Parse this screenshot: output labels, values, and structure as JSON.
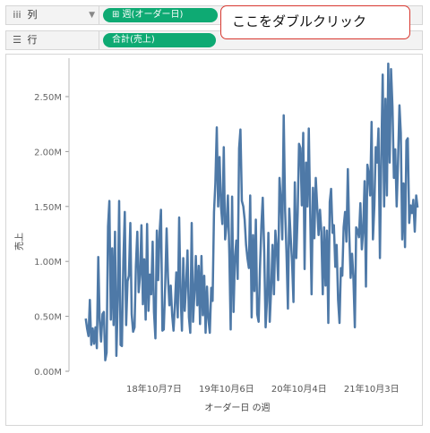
{
  "shelves": {
    "columns": {
      "icon": "iii",
      "label": "列",
      "pill": "⊞ 週(オーダー日)"
    },
    "rows": {
      "icon": "☰",
      "label": "行",
      "pill": "合計(売上)"
    }
  },
  "callout": {
    "text": "ここをダブルクリック"
  },
  "colors": {
    "pill": "#0eaa73",
    "line": "#4e79a7",
    "callout_border": "#d8372f"
  },
  "chart_data": {
    "type": "line",
    "xlabel": "オーダー日 の週",
    "ylabel": "売上",
    "ylim": [
      0,
      2850000
    ],
    "y_ticks": [
      {
        "value": 0,
        "label": "0.00M"
      },
      {
        "value": 500000,
        "label": "0.50M"
      },
      {
        "value": 1000000,
        "label": "1.00M"
      },
      {
        "value": 1500000,
        "label": "1.50M"
      },
      {
        "value": 2000000,
        "label": "2.00M"
      },
      {
        "value": 2500000,
        "label": "2.50M"
      }
    ],
    "x_ticks": [
      {
        "week_index": 49,
        "label": "18年10月7日"
      },
      {
        "week_index": 101,
        "label": "19年10月6日"
      },
      {
        "week_index": 153,
        "label": "20年10月4日"
      },
      {
        "week_index": 205,
        "label": "21年10月3日"
      }
    ],
    "x_range": [
      -12,
      236
    ],
    "grid": "none",
    "series": [
      {
        "values": [
          480000,
          390000,
          320000,
          650000,
          240000,
          390000,
          250000,
          400000,
          210000,
          1040000,
          470000,
          270000,
          520000,
          540000,
          100000,
          170000,
          1320000,
          1550000,
          470000,
          1120000,
          420000,
          1270000,
          140000,
          650000,
          1550000,
          240000,
          230000,
          1000000,
          1450000,
          420000,
          820000,
          870000,
          1350000,
          520000,
          360000,
          400000,
          960000,
          1270000,
          720000,
          880000,
          1330000,
          610000,
          1020000,
          470000,
          1340000,
          550000,
          880000,
          700000,
          1180000,
          540000,
          300000,
          1280000,
          830000,
          1270000,
          1470000,
          370000,
          380000,
          780000,
          1300000,
          860000,
          600000,
          780000,
          510000,
          370000,
          610000,
          900000,
          490000,
          1400000,
          720000,
          370000,
          1030000,
          550000,
          780000,
          1100000,
          490000,
          350000,
          1350000,
          450000,
          720000,
          1050000,
          600000,
          960000,
          430000,
          1050000,
          510000,
          870000,
          350000,
          770000,
          480000,
          350000,
          760000,
          640000,
          1450000,
          1710000,
          2220000,
          1500000,
          1950000,
          1500000,
          1340000,
          2040000,
          1200000,
          1330000,
          1600000,
          1070000,
          380000,
          1590000,
          540000,
          1020000,
          1190000,
          840000,
          2030000,
          2200000,
          1550000,
          1500000,
          1380000,
          1150000,
          1030000,
          940000,
          1600000,
          490000,
          1240000,
          730000,
          1380000,
          520000,
          450000,
          940000,
          1330000,
          1580000,
          1100000,
          400000,
          640000,
          1260000,
          450000,
          750000,
          1150000,
          700000,
          1280000,
          1120000,
          830000,
          1760000,
          1550000,
          1200000,
          2330000,
          1460000,
          1080000,
          570000,
          1480000,
          1220000,
          1000000,
          630000,
          1720000,
          1030000,
          1440000,
          2070000,
          2030000,
          1510000,
          2170000,
          930000,
          1900000,
          1500000,
          2210000,
          1430000,
          700000,
          1670000,
          1210000,
          1760000,
          1510000,
          1240000,
          1470000,
          1270000,
          700000,
          1310000,
          780000,
          1280000,
          440000,
          1540000,
          1660000,
          1260000,
          1330000,
          950000,
          1150000,
          650000,
          440000,
          940000,
          870000,
          1310000,
          1450000,
          1180000,
          1840000,
          1270000,
          850000,
          1070000,
          850000,
          400000,
          1310000,
          1280000,
          1220000,
          1530000,
          1110000,
          1280000,
          1730000,
          770000,
          1880000,
          1800000,
          1600000,
          2270000,
          1200000,
          1510000,
          2040000,
          1900000,
          2210000,
          1030000,
          1940000,
          2700000,
          1500000,
          2480000,
          1600000,
          2800000,
          1900000,
          2750000,
          2410000,
          1760000,
          2020000,
          1500000,
          1900000,
          2420000,
          2170000,
          1200000,
          1710000,
          1130000,
          2100000,
          2120000,
          1350000,
          1510000,
          1440000,
          1560000,
          1270000,
          1600000,
          1490000
        ]
      }
    ]
  }
}
